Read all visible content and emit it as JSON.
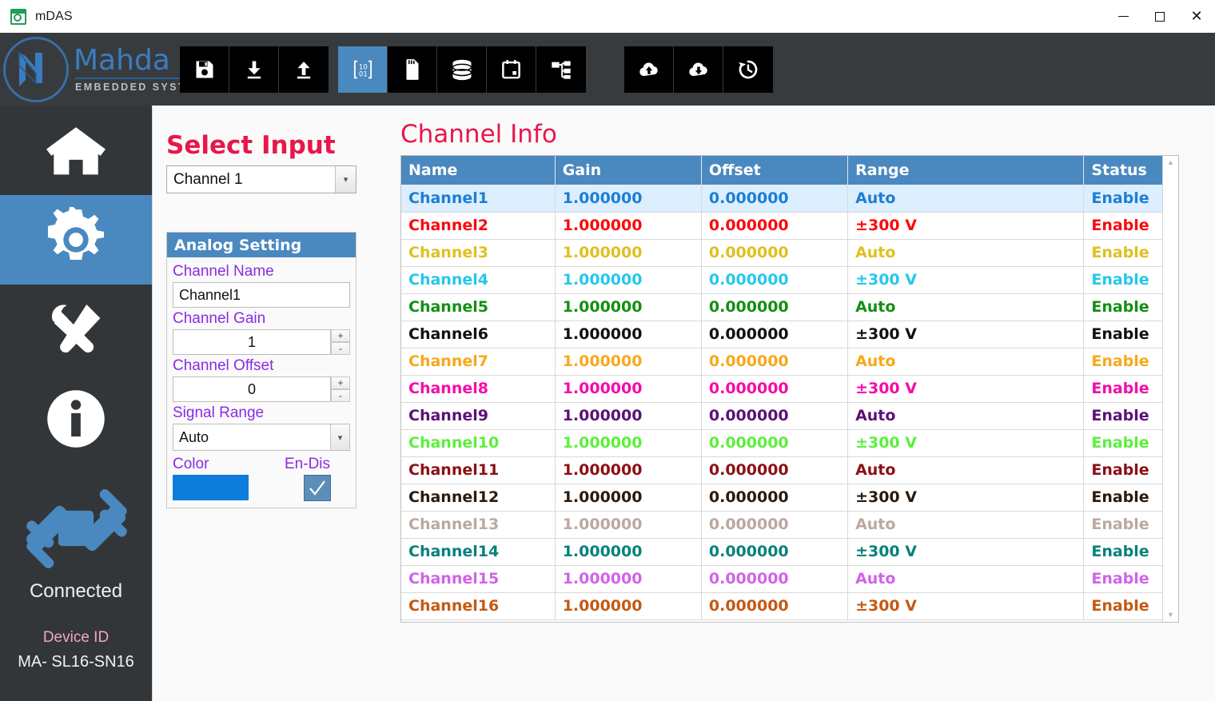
{
  "window": {
    "title": "mDAS",
    "app_icon": "chart-window-icon",
    "controls": {
      "minimize": "minimize-icon",
      "maximize": "maximize-icon",
      "close": "close-icon"
    }
  },
  "brand": {
    "name": "Mahda",
    "tagline": "EMBEDDED SYSTEMS",
    "accent": "#3b7cc0"
  },
  "toolbar": {
    "groups": [
      {
        "name": "file-group",
        "buttons": [
          {
            "icon": "save-floppy-icon",
            "active": false
          },
          {
            "icon": "download-icon",
            "active": false
          },
          {
            "icon": "upload-icon",
            "active": false
          }
        ]
      },
      {
        "name": "data-group",
        "buttons": [
          {
            "icon": "binary-matrix-icon",
            "active": true
          },
          {
            "icon": "sd-card-icon",
            "active": false
          },
          {
            "icon": "database-icon",
            "active": false
          },
          {
            "icon": "calendar-icon",
            "active": false
          },
          {
            "icon": "network-tree-icon",
            "active": false
          }
        ]
      },
      {
        "name": "cloud-group",
        "buttons": [
          {
            "icon": "cloud-upload-icon",
            "active": false
          },
          {
            "icon": "cloud-download-icon",
            "active": false
          },
          {
            "icon": "history-clock-icon",
            "active": false
          }
        ]
      }
    ],
    "active_color": "#4a89bf"
  },
  "sidebar": {
    "items": [
      {
        "icon": "home-icon",
        "name": "home",
        "active": false
      },
      {
        "icon": "gear-icon",
        "name": "settings",
        "active": true
      },
      {
        "icon": "tools-icon",
        "name": "tools",
        "active": false
      },
      {
        "icon": "info-icon",
        "name": "info",
        "active": false
      }
    ],
    "connection": {
      "icon": "plug-connected-icon",
      "status": "Connected",
      "device_id_label": "Device ID",
      "device_id_value": "MA- SL16-SN16"
    }
  },
  "select_input": {
    "title": "Select Input",
    "value": "Channel 1",
    "title_color": "#e8174a"
  },
  "analog_setting": {
    "header": "Analog Setting",
    "fields": {
      "channel_name_label": "Channel Name",
      "channel_name_value": "Channel1",
      "channel_gain_label": "Channel Gain",
      "channel_gain_value": "1",
      "channel_offset_label": "Channel Offset",
      "channel_offset_value": "0",
      "signal_range_label": "Signal Range",
      "signal_range_value": "Auto",
      "color_label": "Color",
      "color_value": "#0d7ddb",
      "endis_label": "En-Dis",
      "endis_checked": true,
      "spin_up": "+",
      "spin_down": "-"
    },
    "label_color": "#8a2be2"
  },
  "channel_info": {
    "title": "Channel Info",
    "columns": [
      "Name",
      "Gain",
      "Offset",
      "Range",
      "Status"
    ],
    "rows": [
      {
        "name": "Channel1",
        "gain": "1.000000",
        "offset": "0.000000",
        "range": "Auto",
        "status": "Enable",
        "color": "#1b7fd4",
        "selected": true
      },
      {
        "name": "Channel2",
        "gain": "1.000000",
        "offset": "0.000000",
        "range": "±300 V",
        "status": "Enable",
        "color": "#fa0a0a",
        "selected": false
      },
      {
        "name": "Channel3",
        "gain": "1.000000",
        "offset": "0.000000",
        "range": "Auto",
        "status": "Enable",
        "color": "#e0c020",
        "selected": false
      },
      {
        "name": "Channel4",
        "gain": "1.000000",
        "offset": "0.000000",
        "range": "±300 V",
        "status": "Enable",
        "color": "#25c7ec",
        "selected": false
      },
      {
        "name": "Channel5",
        "gain": "1.000000",
        "offset": "0.000000",
        "range": "Auto",
        "status": "Enable",
        "color": "#128f12",
        "selected": false
      },
      {
        "name": "Channel6",
        "gain": "1.000000",
        "offset": "0.000000",
        "range": "±300 V",
        "status": "Enable",
        "color": "#111111",
        "selected": false
      },
      {
        "name": "Channel7",
        "gain": "1.000000",
        "offset": "0.000000",
        "range": "Auto",
        "status": "Enable",
        "color": "#f7a81b",
        "selected": false
      },
      {
        "name": "Channel8",
        "gain": "1.000000",
        "offset": "0.000000",
        "range": "±300 V",
        "status": "Enable",
        "color": "#f50cab",
        "selected": false
      },
      {
        "name": "Channel9",
        "gain": "1.000000",
        "offset": "0.000000",
        "range": "Auto",
        "status": "Enable",
        "color": "#5b1277",
        "selected": false
      },
      {
        "name": "Channel10",
        "gain": "1.000000",
        "offset": "0.000000",
        "range": "±300 V",
        "status": "Enable",
        "color": "#5cf03c",
        "selected": false
      },
      {
        "name": "Channel11",
        "gain": "1.000000",
        "offset": "0.000000",
        "range": "Auto",
        "status": "Enable",
        "color": "#8c1015",
        "selected": false
      },
      {
        "name": "Channel12",
        "gain": "1.000000",
        "offset": "0.000000",
        "range": "±300 V",
        "status": "Enable",
        "color": "#2b1a0b",
        "selected": false
      },
      {
        "name": "Channel13",
        "gain": "1.000000",
        "offset": "0.000000",
        "range": "Auto",
        "status": "Enable",
        "color": "#bba8a0",
        "selected": false
      },
      {
        "name": "Channel14",
        "gain": "1.000000",
        "offset": "0.000000",
        "range": "±300 V",
        "status": "Enable",
        "color": "#07817c",
        "selected": false
      },
      {
        "name": "Channel15",
        "gain": "1.000000",
        "offset": "0.000000",
        "range": "Auto",
        "status": "Enable",
        "color": "#d163e8",
        "selected": false
      },
      {
        "name": "Channel16",
        "gain": "1.000000",
        "offset": "0.000000",
        "range": "±300 V",
        "status": "Enable",
        "color": "#c45a14",
        "selected": false
      }
    ],
    "title_color": "#e8174a",
    "header_bg": "#4a89bf",
    "selected_row_bg": "#ddeeff",
    "scrollbar": {
      "up": "scroll-up-arrow-icon",
      "down": "scroll-down-arrow-icon"
    }
  }
}
